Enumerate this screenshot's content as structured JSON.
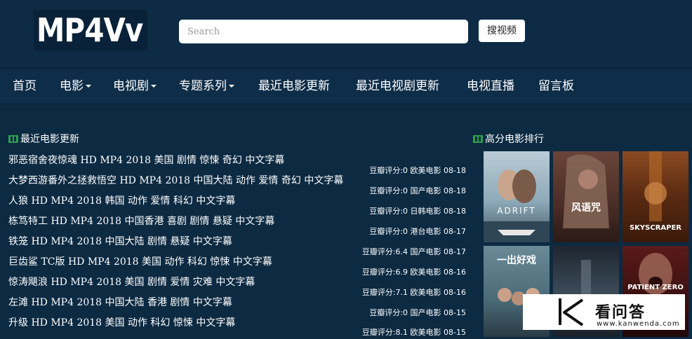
{
  "header": {
    "logo": "MP4Vv",
    "search_placeholder": "Search",
    "search_button": "搜视频"
  },
  "nav": {
    "items": [
      "首页",
      "电影",
      "电视剧",
      "专题系列",
      "最近电影更新",
      "最近电视剧更新",
      "电视直播",
      "留言板"
    ]
  },
  "latest": {
    "title": "最近电影更新",
    "movies": [
      {
        "title": "邪恶宿舍夜惊魂 HD MP4 2018 美国 剧情 惊悚 奇幻 中文字幕",
        "meta": "豆瓣评分:0 欧美电影 08-18"
      },
      {
        "title": "大梦西游番外之拯救悟空 HD MP4 2018 中国大陆 动作 爱情 奇幻 中文字幕",
        "meta": "豆瓣评分:0 国产电影 08-18"
      },
      {
        "title": "人狼 HD MP4 2018 韩国 动作 爱情 科幻 中文字幕",
        "meta": "豆瓣评分:0 日韩电影 08-18"
      },
      {
        "title": "栋笃特工 HD MP4 2018 中国香港 喜剧 剧情 悬疑 中文字幕",
        "meta": "豆瓣评分:0 港台电影 08-17"
      },
      {
        "title": "铁笼 HD MP4 2018 中国大陆 剧情 悬疑 中文字幕",
        "meta": "豆瓣评分:6.4 国产电影 08-17"
      },
      {
        "title": "巨齿鲨 TC版 HD MP4 2018 美国 动作 科幻 惊悚 中文字幕",
        "meta": "豆瓣评分:6.9 欧美电影 08-16"
      },
      {
        "title": "惊涛飓浪 HD MP4 2018 美国 剧情 爱情 灾难 中文字幕",
        "meta": "豆瓣评分:7.1 欧美电影 08-16"
      },
      {
        "title": "左滩 HD MP4 2018 中国大陆 香港 剧情 中文字幕",
        "meta": "豆瓣评分:0 国产电影 08-15"
      },
      {
        "title": "升级 HD MP4 2018 美国 动作 科幻 惊悚 中文字幕",
        "meta": "豆瓣评分:8.1 欧美电影 08-15"
      }
    ]
  },
  "top_rated": {
    "title": "高分电影排行",
    "posters": [
      {
        "name": "ADRIFT",
        "text": "ADRIFT",
        "bg": "#8ba6b3"
      },
      {
        "name": "风语咒",
        "text": "风语咒",
        "bg": "#5a3a32"
      },
      {
        "name": "SKYSCRAPER",
        "text": "SKYSCRAPER",
        "bg": "#7a3f1e"
      },
      {
        "name": "一出好戏",
        "text": "一出好戏",
        "bg": "#3a5a6a"
      },
      {
        "name": "dark-poster",
        "text": "",
        "bg": "#2a3038"
      },
      {
        "name": "woman-poster",
        "text": "",
        "bg": "#3a2a22"
      },
      {
        "name": "PATIENT ZERO",
        "text": "PATIENT ZERO",
        "bg": "#4a1818"
      }
    ]
  },
  "watermark": {
    "title": "看问答",
    "url": "www.kanwenda.com"
  },
  "colors": {
    "background": "#0c2a42",
    "header": "#0d2b45",
    "icon_green": "#2aa04a"
  }
}
